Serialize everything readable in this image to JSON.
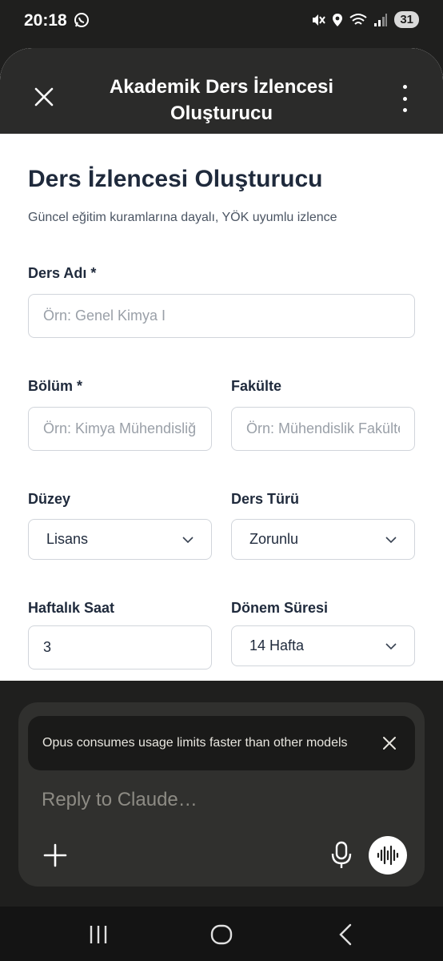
{
  "status_bar": {
    "time": "20:18",
    "battery": "31",
    "icons": [
      "whatsapp-icon",
      "mute-icon",
      "location-icon",
      "wifi-icon",
      "signal-icon"
    ]
  },
  "header": {
    "title": "Akademik Ders İzlencesi Oluşturucu",
    "close_icon": "close-icon",
    "menu_icon": "more-vertical-icon"
  },
  "form": {
    "title": "Ders İzlencesi Oluşturucu",
    "subtitle": "Güncel eğitim kuramlarına dayalı, YÖK uyumlu izlence",
    "course_name": {
      "label": "Ders Adı *",
      "placeholder": "Örn: Genel Kimya I",
      "value": ""
    },
    "department": {
      "label": "Bölüm *",
      "placeholder": "Örn: Kimya Mühendisliği",
      "value": ""
    },
    "faculty": {
      "label": "Fakülte",
      "placeholder": "Örn: Mühendislik Fakültesi",
      "value": ""
    },
    "level": {
      "label": "Düzey",
      "selected": "Lisans"
    },
    "course_type": {
      "label": "Ders Türü",
      "selected": "Zorunlu"
    },
    "weekly_hours": {
      "label": "Haftalık Saat",
      "value": "3"
    },
    "term_length": {
      "label": "Dönem Süresi",
      "selected": "14 Hafta"
    }
  },
  "chat": {
    "toast_text": "Opus consumes usage limits faster than other models",
    "reply_placeholder": "Reply to Claude…"
  },
  "colors": {
    "header_bg": "#2b2b2a",
    "title_text": "#1f2a3c",
    "chat_bg": "#1f1f1e",
    "composer_bg": "#30302e"
  }
}
